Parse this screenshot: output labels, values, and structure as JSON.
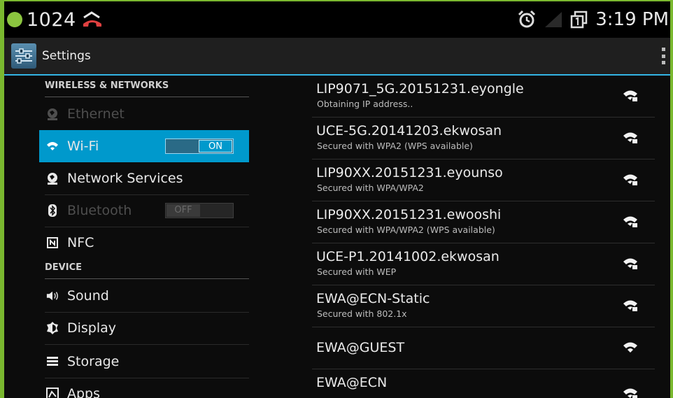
{
  "status_bar": {
    "notification_count": "1024",
    "time": "3:19 PM"
  },
  "action_bar": {
    "title": "Settings"
  },
  "sidebar": {
    "sections": [
      {
        "header": "WIRELESS & NETWORKS"
      },
      {
        "header": "DEVICE"
      }
    ],
    "items": [
      {
        "label": "Ethernet",
        "icon": "globe-icon",
        "state": "disabled"
      },
      {
        "label": "Wi-Fi",
        "icon": "wifi-icon",
        "state": "selected",
        "toggle": "ON"
      },
      {
        "label": "Network Services",
        "icon": "globe-icon",
        "state": "normal"
      },
      {
        "label": "Bluetooth",
        "icon": "bluetooth-icon",
        "state": "disabled",
        "toggle": "OFF"
      },
      {
        "label": "NFC",
        "icon": "nfc-icon",
        "state": "normal"
      },
      {
        "label": "Sound",
        "icon": "speaker-icon",
        "state": "normal"
      },
      {
        "label": "Display",
        "icon": "brightness-icon",
        "state": "normal"
      },
      {
        "label": "Storage",
        "icon": "storage-icon",
        "state": "normal"
      },
      {
        "label": "Apps",
        "icon": "apps-icon",
        "state": "normal"
      }
    ]
  },
  "wifi_networks": [
    {
      "ssid": "LIP9071_5G.20151231.eyongle",
      "status": "Obtaining IP address..",
      "secured": true
    },
    {
      "ssid": "UCE-5G.20141203.ekwosan",
      "status": "Secured with WPA2 (WPS available)",
      "secured": true
    },
    {
      "ssid": "LIP90XX.20151231.eyounso",
      "status": "Secured with WPA/WPA2",
      "secured": true
    },
    {
      "ssid": "LIP90XX.20151231.ewooshi",
      "status": "Secured with WPA/WPA2 (WPS available)",
      "secured": true
    },
    {
      "ssid": "UCE-P1.20141002.ekwosan",
      "status": "Secured with WEP",
      "secured": true
    },
    {
      "ssid": "EWA@ECN-Static",
      "status": "Secured with 802.1x",
      "secured": true
    },
    {
      "ssid": "EWA@GUEST",
      "status": "",
      "secured": false
    },
    {
      "ssid": "EWA@ECN",
      "status": "",
      "secured": true
    }
  ],
  "colors": {
    "accent": "#33b5e5",
    "selected_bg": "#0099cc",
    "frame": "#7ab82f"
  }
}
